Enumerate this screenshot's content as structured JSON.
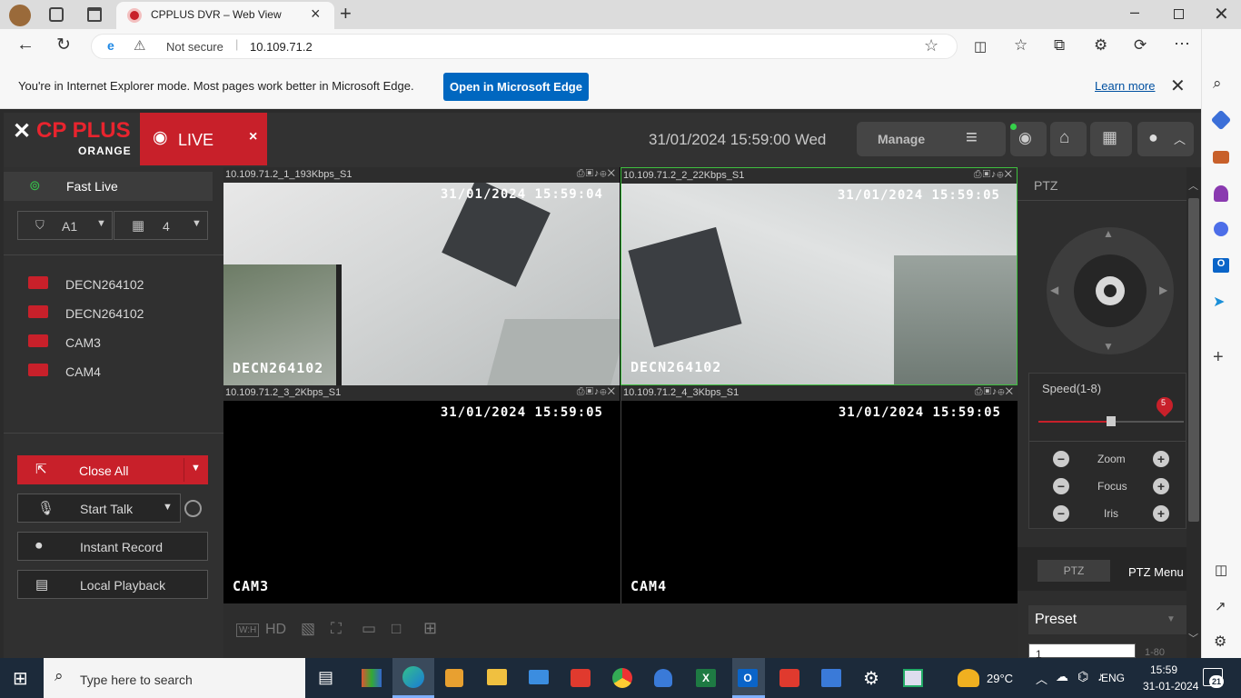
{
  "browser": {
    "tab_title": "CPPLUS DVR – Web View",
    "security_label": "Not secure",
    "url": "10.109.71.2",
    "ie_notice": "You're in Internet Explorer mode. Most pages work better in Microsoft Edge.",
    "open_edge_label": "Open in Microsoft Edge",
    "learn_more": "Learn more"
  },
  "dvr": {
    "logo_main": "CP PLUS",
    "logo_sub": "ORANGE",
    "live_tab": "LIVE",
    "datetime": "31/01/2024 15:59:00 Wed",
    "manage_label": "Manage"
  },
  "left": {
    "fast_live": "Fast Live",
    "stream_label": "A1",
    "layout_count": "4",
    "devices": [
      "DECN264102",
      "DECN264102",
      "CAM3",
      "CAM4"
    ],
    "close_all": "Close All",
    "start_talk": "Start Talk",
    "instant_record": "Instant Record",
    "local_playback": "Local Playback"
  },
  "cameras": [
    {
      "header": "10.109.71.2_1_193Kbps_S1",
      "timestamp": "31/01/2024 15:59:04",
      "name": "DECN264102"
    },
    {
      "header": "10.109.71.2_2_22Kbps_S1",
      "timestamp": "31/01/2024 15:59:05",
      "name": "DECN264102"
    },
    {
      "header": "10.109.71.2_3_2Kbps_S1",
      "timestamp": "31/01/2024 15:59:05",
      "name": "CAM3"
    },
    {
      "header": "10.109.71.2_4_3Kbps_S1",
      "timestamp": "31/01/2024 15:59:05",
      "name": "CAM4"
    }
  ],
  "toolbar": {
    "ratio_label": "W:H",
    "hd_label": "HD"
  },
  "ptz": {
    "title": "PTZ",
    "speed_label": "Speed(1-8)",
    "speed_value": "5",
    "speed_fraction": 0.5,
    "zoom": "Zoom",
    "focus": "Focus",
    "iris": "Iris",
    "tab_ptz": "PTZ",
    "tab_menu": "PTZ Menu",
    "preset_label": "Preset",
    "preset_input": "1",
    "preset_range": "1-80"
  },
  "taskbar": {
    "search_placeholder": "Type here to search",
    "weather": "29°C",
    "language": "ENG",
    "time": "15:59",
    "date": "31-01-2024",
    "notifications": "21"
  },
  "colors": {
    "accent_red": "#c8202a",
    "edge_blue": "#0067c0",
    "selected_border": "#3fbf3f"
  }
}
